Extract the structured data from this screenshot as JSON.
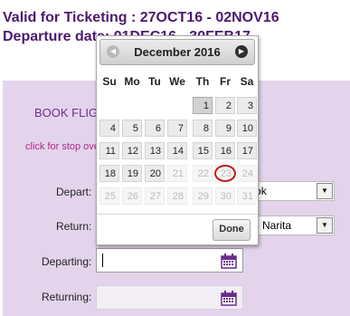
{
  "header": {
    "line1": "Valid for Ticketing : 27OCT16 - 02NOV16",
    "line2": "Departure date: 01DEC16 - 30FEB17"
  },
  "form": {
    "title": "BOOK FLIGHTS",
    "stopover_link": "click for stop over",
    "depart_label": "Depart:",
    "depart_value": "Bangkok",
    "return_label": "Return:",
    "return_value": "Tokyo - Narita",
    "departing_label": "Departing:",
    "returning_label": "Returning:",
    "departing_value": "",
    "returning_value": ""
  },
  "datepicker": {
    "month_year": "December 2016",
    "prev_icon": "chevron-left-icon",
    "next_icon": "chevron-right-icon",
    "weekdays": [
      "Su",
      "Mo",
      "Tu",
      "We",
      "Th",
      "Fr",
      "Sa"
    ],
    "done_label": "Done",
    "today": "1",
    "highlighted": "23",
    "weeks": [
      [
        "",
        "",
        "",
        "",
        "1",
        "2",
        "3"
      ],
      [
        "4",
        "5",
        "6",
        "7",
        "8",
        "9",
        "10"
      ],
      [
        "11",
        "12",
        "13",
        "14",
        "15",
        "16",
        "17"
      ],
      [
        "18",
        "19",
        "20",
        "21",
        "22",
        "23",
        "24"
      ],
      [
        "25",
        "26",
        "27",
        "28",
        "29",
        "30",
        "31"
      ]
    ],
    "available_through": "20"
  },
  "colors": {
    "header_text": "#4b1a6e",
    "panel_bg": "#e3d4ec",
    "link": "#b0288a",
    "highlight_ring": "#c41b1b",
    "calendar_icon": "#6a2c8e"
  }
}
